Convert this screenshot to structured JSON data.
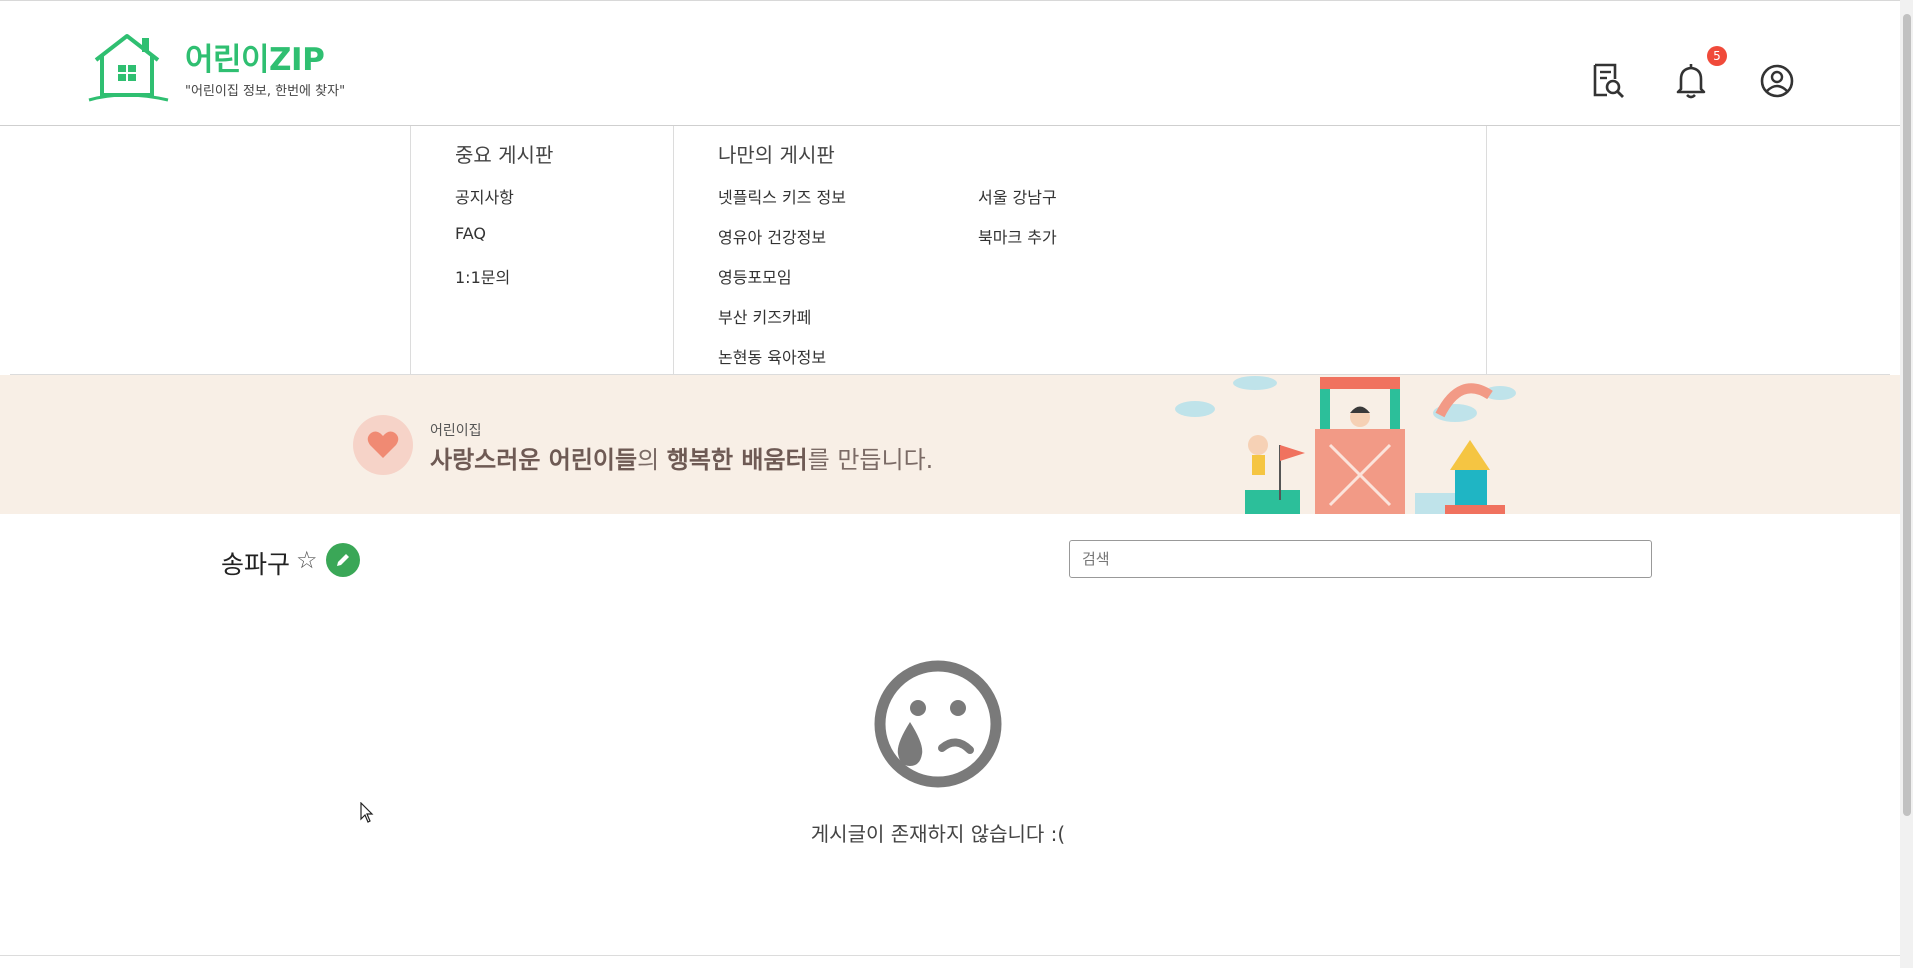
{
  "header": {
    "brand": "어린이ZIP",
    "tagline": "\"어린이집 정보, 한번에 찾자\"",
    "icons": [
      "search-document-icon",
      "bell-icon",
      "user-circle-icon"
    ],
    "notification_count": "5",
    "brand_color": "#2fbf71"
  },
  "menu": {
    "important_heading": "중요 게시판",
    "important_items": [
      "공지사항",
      "FAQ",
      "1:1문의"
    ],
    "my_heading": "나만의 게시판",
    "my_items_col1": [
      "넷플릭스 키즈 정보",
      "영유아 건강정보",
      "영등포모임",
      "부산 키즈카페",
      "논현동 육아정보"
    ],
    "my_items_col2": [
      "서울 강남구",
      "북마크 추가"
    ]
  },
  "banner": {
    "small": "어린이집",
    "main_part1": "사랑스러운 어린이들",
    "main_part2": "의 ",
    "main_part3": "행복한 배움터",
    "main_part4": "를 만듭니다."
  },
  "board": {
    "title": "송파구",
    "star_symbol": "☆",
    "search_placeholder": "검색"
  },
  "empty": {
    "message": "게시글이 존재하지 않습니다 :("
  }
}
